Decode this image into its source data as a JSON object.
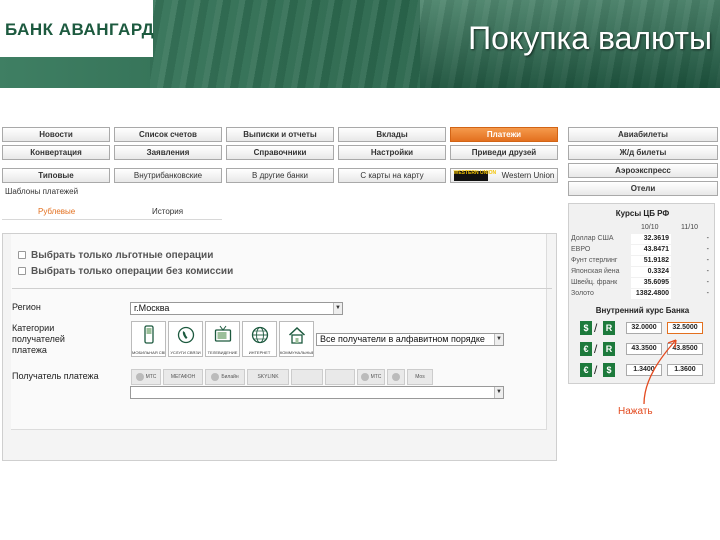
{
  "header": {
    "logo": "БАНК АВАНГАРД",
    "title": "Покупка валюты"
  },
  "nav": {
    "row1": [
      "Новости",
      "Список счетов",
      "Выписки и отчеты",
      "Вклады",
      "Платежи"
    ],
    "row2": [
      "Конвертация",
      "Заявления",
      "Справочники",
      "Настройки",
      "Приведи друзей"
    ],
    "row3": [
      "Типовые",
      "Внутрибанковские",
      "В другие банки",
      "С карты на карту",
      "Western Union"
    ],
    "active": "Платежи",
    "wu_logo": "WESTERN UNION"
  },
  "subnav": {
    "templates": "Шаблоны платежей",
    "tab_ruble": "Рублевые",
    "tab_history": "История"
  },
  "filters": {
    "preferential": "Выбрать только льготные операции",
    "no_commission": "Выбрать только операции без комиссии"
  },
  "form": {
    "region_label": "Регион",
    "region_value": "г.Москва",
    "category_label": "Категории получателей платежа",
    "category_select": "Все получатели в алфавитном порядке",
    "categories": [
      {
        "caption": "МОБИЛЬНАЯ СВЯЗЬ",
        "icon": "mobile-phone-icon"
      },
      {
        "caption": "УСЛУГИ СВЯЗИ",
        "icon": "telephone-icon"
      },
      {
        "caption": "ТЕЛЕВИДЕНИЕ",
        "icon": "tv-icon"
      },
      {
        "caption": "ИНТЕРНЕТ",
        "icon": "globe-icon"
      },
      {
        "caption": "КОММУНАЛЬНЫЕ УСЛУГИ",
        "icon": "house-icon"
      }
    ],
    "recipient_label": "Получатель платежа",
    "recipients": [
      "МТС",
      "МЕГАФОН",
      "Билайн",
      "SKYLINK",
      "",
      "",
      "МТС",
      "",
      "Mos"
    ]
  },
  "right_menu": [
    "Авиабилеты",
    "Ж/д билеты",
    "Аэроэкспресс",
    "Отели"
  ],
  "rates": {
    "title": "Курсы ЦБ РФ",
    "date1": "10/10",
    "date2": "11/10",
    "rows": [
      {
        "name": "Доллар США",
        "v1": "32.3619",
        "v2": "-"
      },
      {
        "name": "ЕВРО",
        "v1": "43.8471",
        "v2": "-"
      },
      {
        "name": "Фунт стерлинг",
        "v1": "51.9182",
        "v2": "-"
      },
      {
        "name": "Японская йена",
        "v1": "0.3324",
        "v2": "-"
      },
      {
        "name": "Швейц. франк",
        "v1": "35.6095",
        "v2": "-"
      },
      {
        "name": "Золото",
        "v1": "1382.4800",
        "v2": "-"
      }
    ],
    "inner_title": "Внутренний курс Банка",
    "inner": [
      {
        "from": "$",
        "to": "R",
        "buy": "32.0000",
        "sell": "32.5000"
      },
      {
        "from": "€",
        "to": "R",
        "buy": "43.3500",
        "sell": "43.8500"
      },
      {
        "from": "€",
        "to": "$",
        "buy": "1.3400",
        "sell": "1.3600"
      }
    ],
    "click_hint": "Нажать"
  },
  "colors": {
    "accent": "#e3701f",
    "header": "#2e6a50",
    "brand": "#1d5a3f"
  }
}
